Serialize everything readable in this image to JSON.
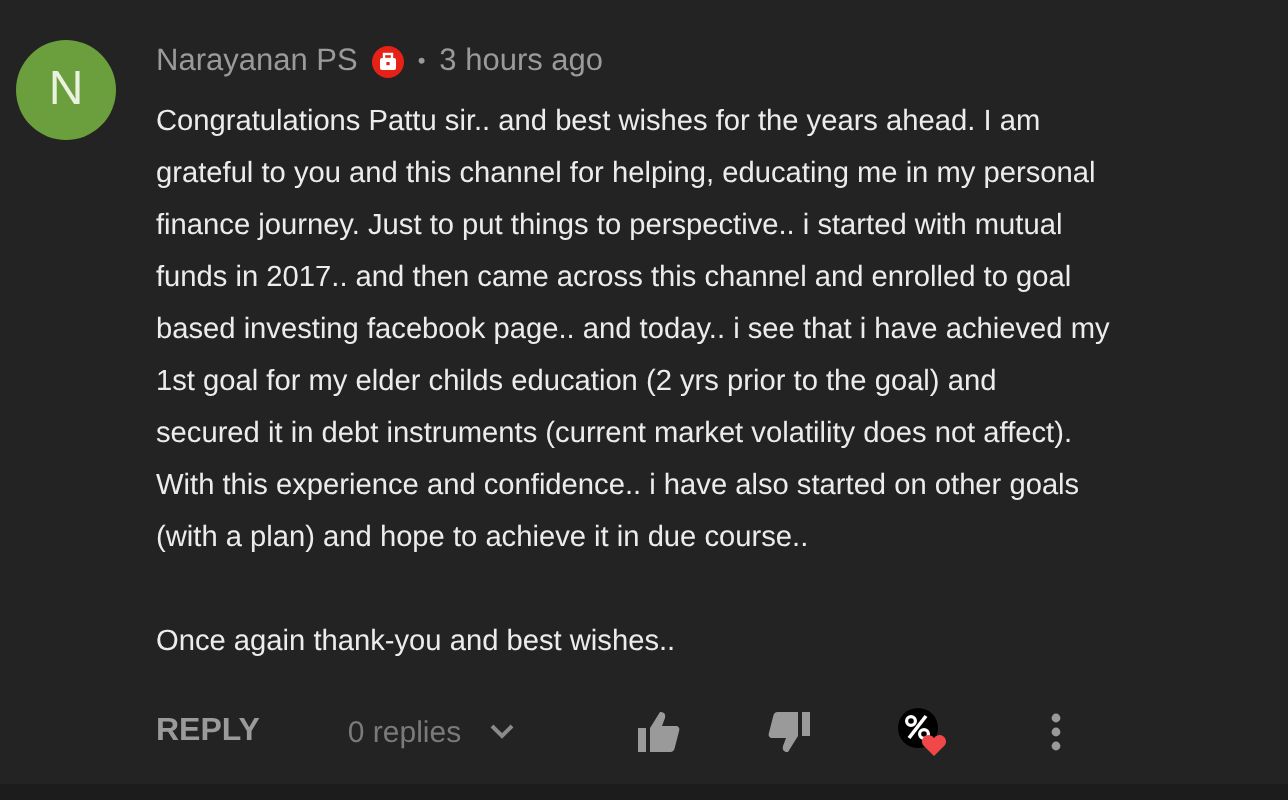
{
  "comment": {
    "avatar_letter": "N",
    "author": "Narayanan PS",
    "separator": "•",
    "time": "3 hours ago",
    "paragraphs": [
      "Congratulations Pattu sir.. and best wishes for the years ahead. I am\ngrateful to you and this channel for helping, educating me in my personal\nfinance journey. Just to put things to perspective.. i started with mutual\nfunds in 2017.. and then came across this channel and enrolled to goal\nbased investing facebook page.. and today.. i see that i have achieved my\n1st goal for my elder childs education (2 yrs prior to the goal) and\nsecured it in debt instruments (current market volatility does not affect).\nWith this experience and confidence.. i have also started on other goals\n(with a plan) and hope to achieve it in due course..",
      "Once again thank-you and best wishes.."
    ],
    "reply_label": "REPLY",
    "replies": "0 replies",
    "creator_hearted": true
  }
}
